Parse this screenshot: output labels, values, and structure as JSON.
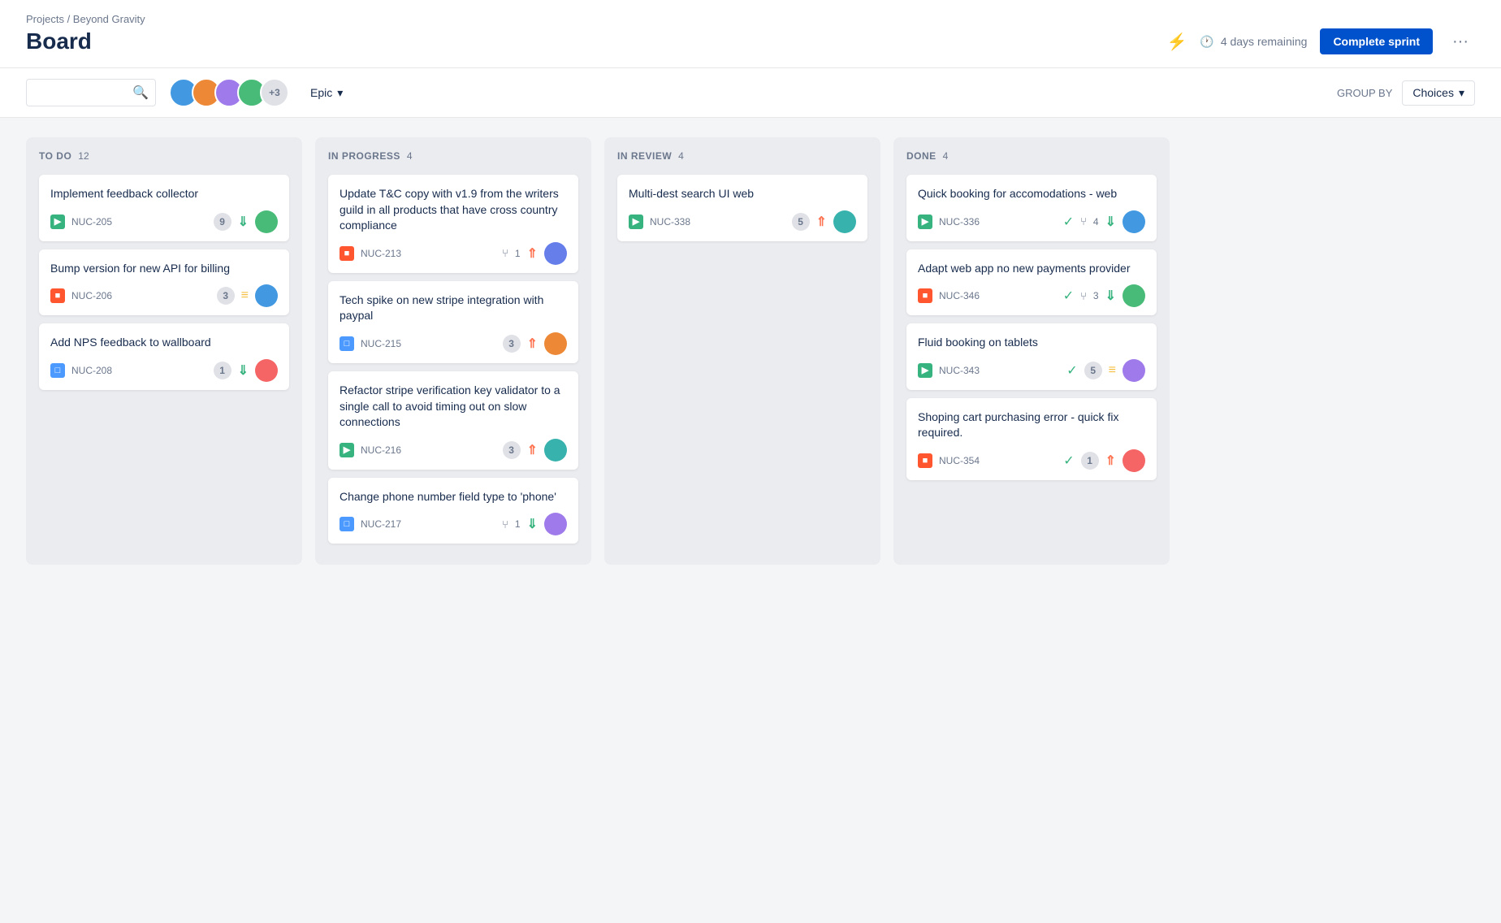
{
  "breadcrumb": "Projects / Beyond Gravity",
  "title": "Board",
  "sprint": {
    "days_remaining": "4 days remaining",
    "complete_label": "Complete sprint",
    "more_label": "···"
  },
  "toolbar": {
    "search_placeholder": "",
    "epic_label": "Epic",
    "group_by_label": "GROUP BY",
    "choices_label": "Choices",
    "avatar_count": "+3"
  },
  "columns": [
    {
      "id": "todo",
      "title": "TO DO",
      "count": 12,
      "cards": [
        {
          "title": "Implement feedback collector",
          "issue_id": "NUC-205",
          "issue_type": "story",
          "badge": "9",
          "priority": "low",
          "assignee_color": "av4"
        },
        {
          "title": "Bump version for new API for billing",
          "issue_id": "NUC-206",
          "issue_type": "bug",
          "badge": "3",
          "priority": "medium",
          "assignee_color": "av1"
        },
        {
          "title": "Add NPS feedback to wallboard",
          "issue_id": "NUC-208",
          "issue_type": "task",
          "badge": "1",
          "priority": "low",
          "assignee_color": "av5"
        }
      ]
    },
    {
      "id": "inprogress",
      "title": "IN PROGRESS",
      "count": 4,
      "cards": [
        {
          "title": "Update T&C copy with v1.9 from the writers guild in all products that have cross country compliance",
          "issue_id": "NUC-213",
          "issue_type": "bug",
          "has_branch": true,
          "branch_count": "1",
          "priority": "high",
          "assignee_color": "av6"
        },
        {
          "title": "Tech spike on new stripe integration with paypal",
          "issue_id": "NUC-215",
          "issue_type": "task",
          "badge": "3",
          "priority": "high",
          "assignee_color": "av2"
        },
        {
          "title": "Refactor stripe verification key validator to a single call to avoid timing out on slow connections",
          "issue_id": "NUC-216",
          "issue_type": "story",
          "badge": "3",
          "priority": "high",
          "assignee_color": "av7"
        },
        {
          "title": "Change phone number field type to 'phone'",
          "issue_id": "NUC-217",
          "issue_type": "task",
          "has_branch": true,
          "branch_count": "1",
          "priority": "low",
          "assignee_color": "av3"
        }
      ]
    },
    {
      "id": "inreview",
      "title": "IN REVIEW",
      "count": 4,
      "cards": [
        {
          "title": "Multi-dest search UI web",
          "issue_id": "NUC-338",
          "issue_type": "story",
          "badge": "5",
          "priority": "high",
          "assignee_color": "av7"
        }
      ]
    },
    {
      "id": "done",
      "title": "DONE",
      "count": 4,
      "cards": [
        {
          "title": "Quick booking for accomodations - web",
          "issue_id": "NUC-336",
          "issue_type": "story",
          "checkmark": true,
          "has_branch": true,
          "branch_count": "4",
          "priority": "low",
          "assignee_color": "av1"
        },
        {
          "title": "Adapt web app no new payments provider",
          "issue_id": "NUC-346",
          "issue_type": "bug",
          "checkmark": true,
          "has_branch": true,
          "branch_count": "3",
          "priority": "low",
          "assignee_color": "av4"
        },
        {
          "title": "Fluid booking on tablets",
          "issue_id": "NUC-343",
          "issue_type": "story",
          "checkmark": true,
          "badge": "5",
          "priority": "medium",
          "assignee_color": "av3"
        },
        {
          "title": "Shoping cart purchasing error - quick fix required.",
          "issue_id": "NUC-354",
          "issue_type": "bug",
          "checkmark": true,
          "badge": "1",
          "priority": "high",
          "assignee_color": "av5"
        }
      ]
    }
  ]
}
